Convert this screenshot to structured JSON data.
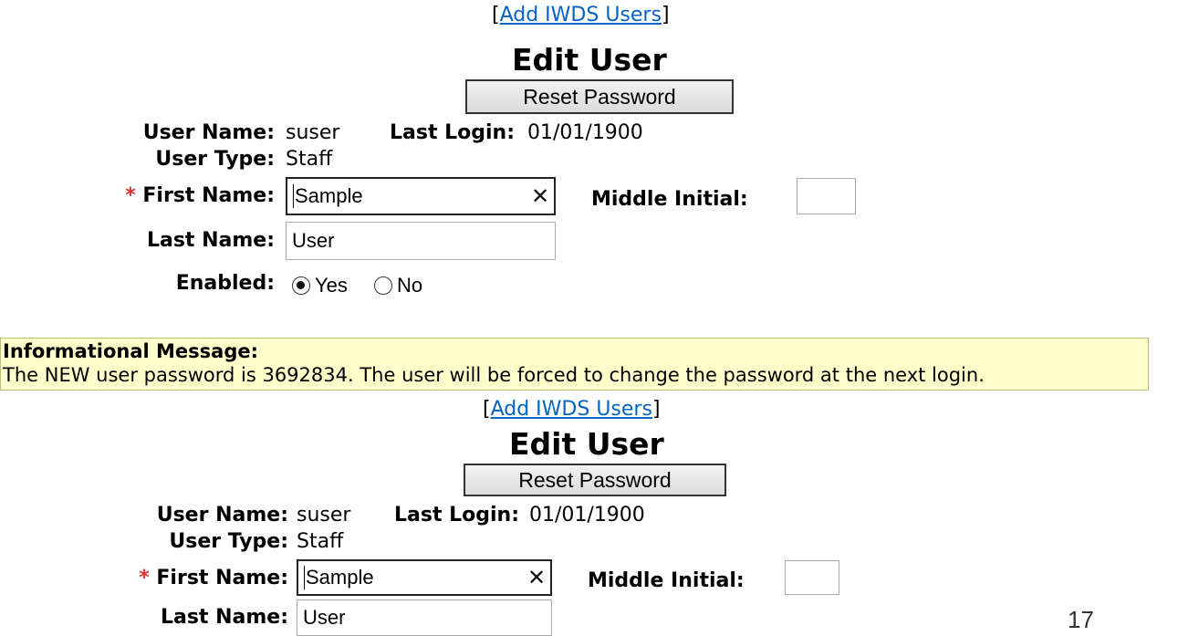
{
  "top_form": {
    "link_open": "[",
    "link_text": "Add IWDS Users",
    "link_close": "]",
    "title": "Edit User",
    "reset_button": "Reset Password",
    "user_name_label": "User Name:",
    "user_name_value": "suser",
    "last_login_label": "Last Login:",
    "last_login_value": "01/01/1900",
    "user_type_label": "User Type:",
    "user_type_value": "Staff",
    "required_marker": "*",
    "first_name_label": "First Name:",
    "first_name_value": "Sample",
    "clear_symbol": "✕",
    "middle_initial_label": "Middle Initial:",
    "middle_initial_value": "",
    "last_name_label": "Last Name:",
    "last_name_value": "User",
    "enabled_label": "Enabled:",
    "enabled_yes": "Yes",
    "enabled_no": "No",
    "enabled_selected": "Yes"
  },
  "message": {
    "title": "Informational Message:",
    "text": "The NEW user password is 3692834. The user will be forced to change the password at the next login."
  },
  "bottom_form": {
    "link_open": "[",
    "link_text": "Add IWDS Users",
    "link_close": "]",
    "title": "Edit User",
    "reset_button": "Reset Password",
    "user_name_label": "User Name:",
    "user_name_value": "suser",
    "last_login_label": "Last Login:",
    "last_login_value": "01/01/1900",
    "user_type_label": "User Type:",
    "user_type_value": "Staff",
    "required_marker": "*",
    "first_name_label": "First Name:",
    "first_name_value": "Sample",
    "clear_symbol": "✕",
    "middle_initial_label": "Middle Initial:",
    "middle_initial_value": "",
    "last_name_label": "Last Name:",
    "last_name_value": "User"
  },
  "page_number": "17"
}
